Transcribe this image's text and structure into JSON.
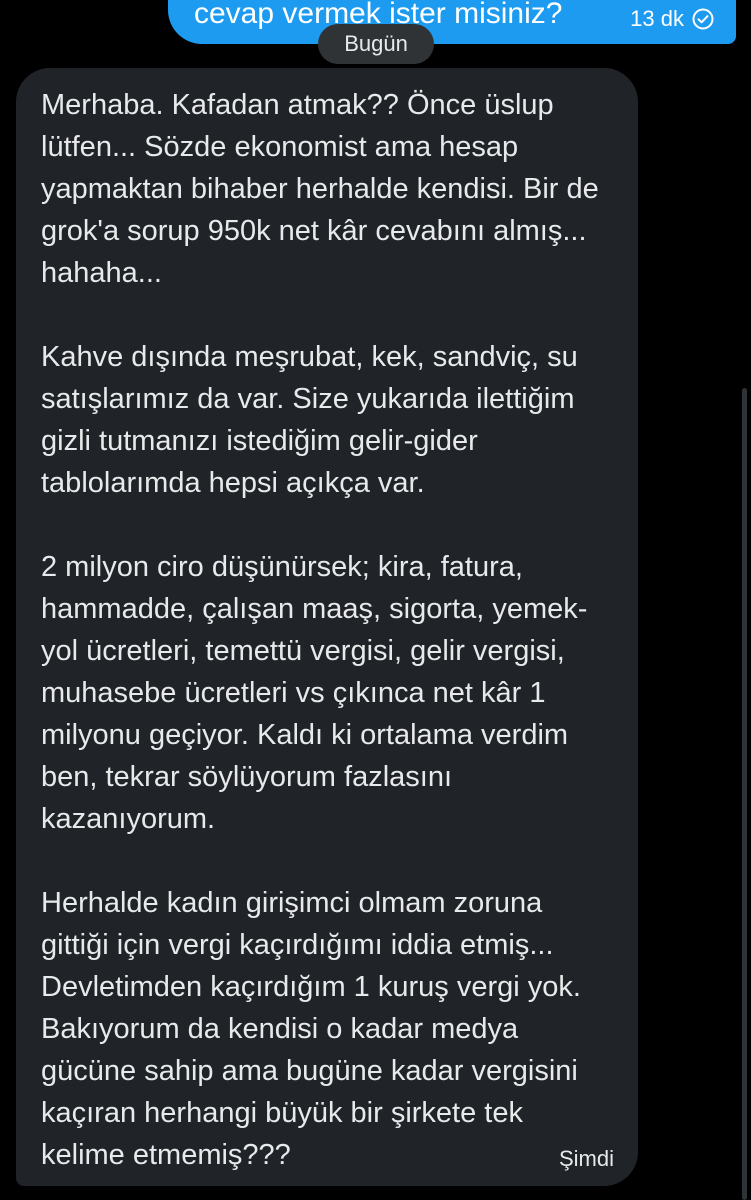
{
  "sent_message": {
    "text": "cevap vermek ister misiniz?",
    "time": "13 dk",
    "status_icon": "check-circle-icon"
  },
  "date_separator": "Bugün",
  "received_message": {
    "paragraphs": [
      "Merhaba. Kafadan atmak?? Önce üslup\nlütfen... Sözde ekonomist ama hesap\nyapmaktan bihaber herhalde kendisi. Bir de\ngrok'a sorup 950k net kâr cevabını almış...\nhahaha...",
      "Kahve dışında meşrubat, kek, sandviç, su\nsatışlarımız da var. Size yukarıda ilettiğim\ngizli tutmanızı istediğim gelir-gider\ntablolarımda hepsi açıkça var.",
      "2 milyon ciro düşünürsek; kira, fatura,\nhammadde, çalışan maaş, sigorta, yemek-\nyol ücretleri, temettü vergisi, gelir vergisi,\nmuhasebe ücretleri vs çıkınca net kâr 1\nmilyonu geçiyor. Kaldı ki ortalama verdim\nben, tekrar söylüyorum fazlasını\nkazanıyorum.",
      "Herhalde kadın girişimci olmam zoruna\ngittiği için vergi kaçırdığımı iddia etmiş...\nDevletimden kaçırdığım 1 kuruş vergi yok.\nBakıyorum da kendisi o kadar medya\ngücüne sahip ama bugüne kadar vergisini\nkaçıran herhangi büyük bir şirkete tek\nkelime etmemiş???"
    ],
    "time": "Şimdi"
  },
  "colors": {
    "background": "#000000",
    "sent_bubble": "#1d9bf0",
    "received_bubble": "#202327",
    "date_pill": "#2f3336",
    "text": "#e7e9ea"
  }
}
